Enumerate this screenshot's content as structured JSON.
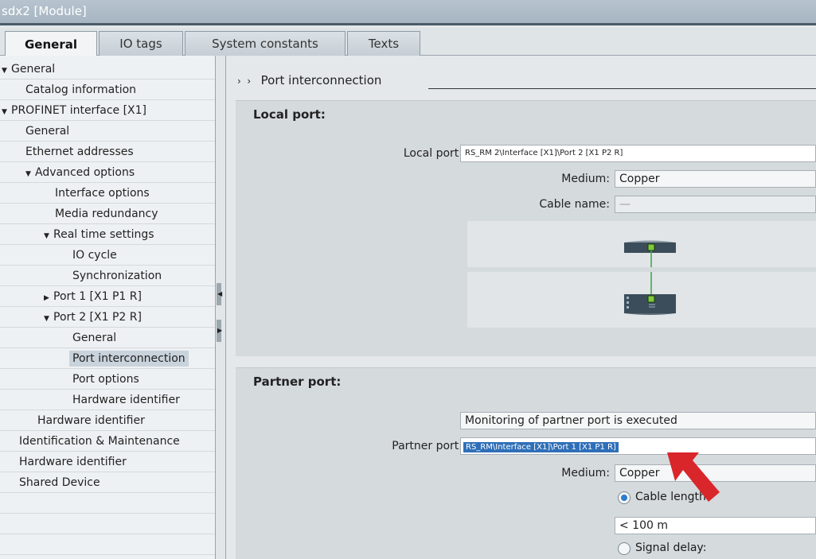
{
  "window": {
    "title": "sdx2 [Module]"
  },
  "tabs": [
    {
      "label": "General"
    },
    {
      "label": "IO tags"
    },
    {
      "label": "System constants"
    },
    {
      "label": "Texts"
    }
  ],
  "tree": [
    {
      "label": "General"
    },
    {
      "label": "Catalog information"
    },
    {
      "label": "PROFINET interface [X1]"
    },
    {
      "label": "General"
    },
    {
      "label": "Ethernet addresses"
    },
    {
      "label": "Advanced options"
    },
    {
      "label": "Interface options"
    },
    {
      "label": "Media redundancy"
    },
    {
      "label": "Real time settings"
    },
    {
      "label": "IO cycle"
    },
    {
      "label": "Synchronization"
    },
    {
      "label": "Port 1 [X1 P1 R]"
    },
    {
      "label": "Port 2 [X1 P2 R]"
    },
    {
      "label": "General"
    },
    {
      "label": "Port interconnection"
    },
    {
      "label": "Port options"
    },
    {
      "label": "Hardware identifier"
    },
    {
      "label": "Hardware identifier"
    },
    {
      "label": "Identification & Maintenance"
    },
    {
      "label": "Hardware identifier"
    },
    {
      "label": "Shared Device"
    }
  ],
  "content": {
    "breadcrumb": "Port interconnection",
    "local": {
      "title": "Local port:",
      "port_label": "Local port:",
      "port_value": "RS_RM 2\\Interface [X1]\\Port 2 [X1 P2 R]",
      "medium_label": "Medium:",
      "medium_value": "Copper",
      "cable_label": "Cable name:",
      "cable_value": "—"
    },
    "partner": {
      "title": "Partner port:",
      "monitoring": "Monitoring of partner port is executed",
      "port_label": "Partner port:",
      "port_value": "RS_RM\\Interface [X1]\\Port 1 [X1 P1 R]",
      "medium_label": "Medium:",
      "medium_value": "Copper",
      "cable_length_label": "Cable length:",
      "cable_length_value": "< 100 m",
      "signal_delay_label": "Signal delay:"
    }
  },
  "colors": {
    "selection": "#2f6fb8",
    "port_link": "#3aa63a",
    "annotation_arrow": "#d9262b"
  }
}
